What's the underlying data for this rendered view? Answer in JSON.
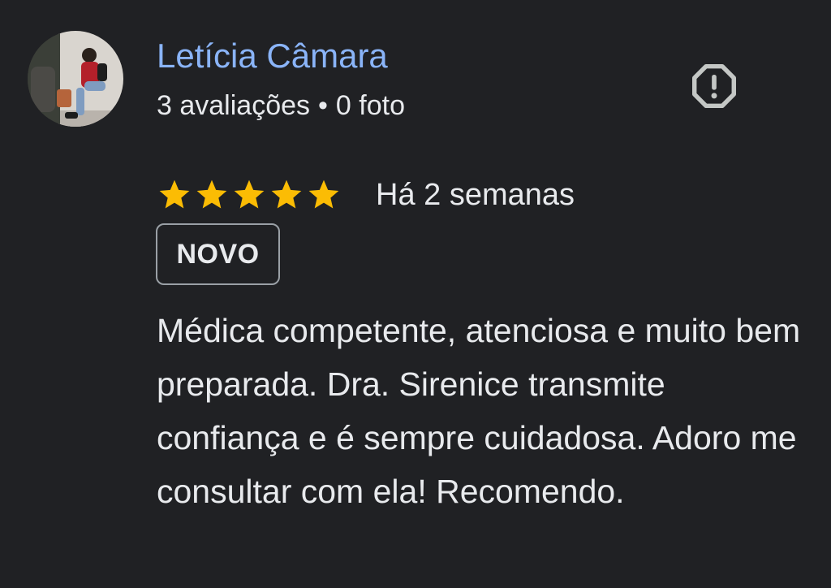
{
  "review": {
    "author": {
      "name": "Letícia Câmara",
      "reviews_count": "3 avaliações",
      "separator": "•",
      "photos_count": "0 foto",
      "avatar_icon": "user-photo-avatar"
    },
    "flag_icon": "report-octagon-icon",
    "rating": {
      "stars": 5,
      "max": 5,
      "color": "#fbbc04"
    },
    "date": "Há 2 semanas",
    "badge": "NOVO",
    "text": "Médica competente, atenciosa e muito bem preparada. Dra. Sirenice transmite confiança e é sempre cuidadosa. Adoro me consultar com ela! Recomendo."
  },
  "colors": {
    "background": "#202124",
    "author_name": "#8ab4f8",
    "text": "#e8eaed",
    "icon": "#c4c7c5",
    "badge_border": "#9aa0a6"
  }
}
